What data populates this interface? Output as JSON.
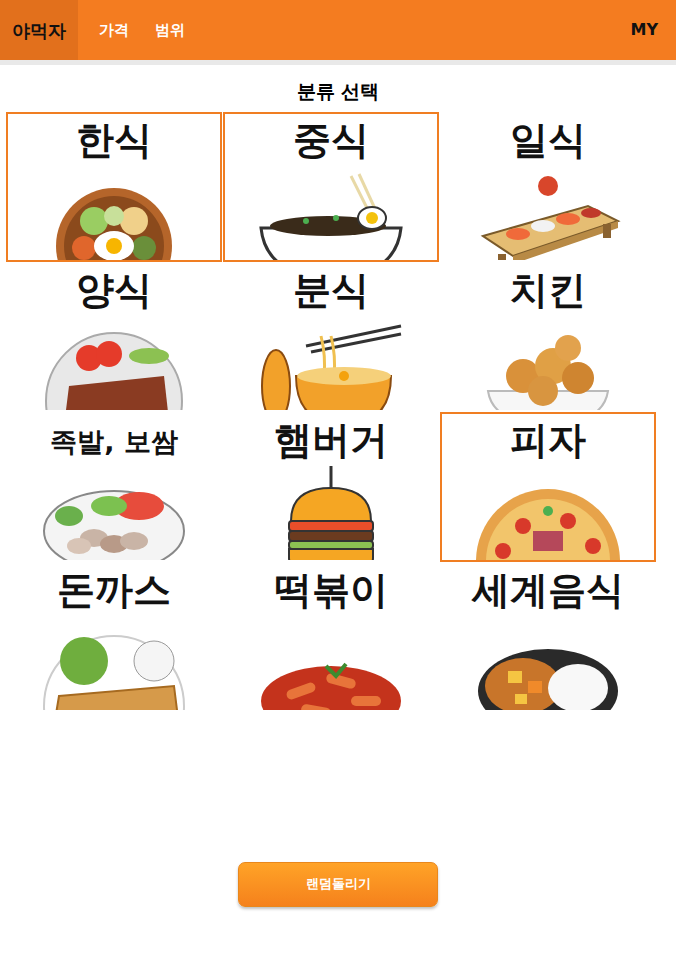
{
  "nav": {
    "logo": "야먹자",
    "items": [
      {
        "label": "가격"
      },
      {
        "label": "범위"
      }
    ],
    "my": "MY"
  },
  "title": "분류 선택",
  "categories": [
    {
      "label": "한식",
      "selected": true
    },
    {
      "label": "중식",
      "selected": true
    },
    {
      "label": "일식",
      "selected": false
    },
    {
      "label": "양식",
      "selected": false
    },
    {
      "label": "분식",
      "selected": false
    },
    {
      "label": "치킨",
      "selected": false
    },
    {
      "label": "족발, 보쌈",
      "selected": false
    },
    {
      "label": "햄버거",
      "selected": false
    },
    {
      "label": "피자",
      "selected": true
    },
    {
      "label": "돈까스",
      "selected": false
    },
    {
      "label": "떡볶이",
      "selected": false
    },
    {
      "label": "세계음식",
      "selected": false
    }
  ],
  "button": "랜덤돌리기"
}
